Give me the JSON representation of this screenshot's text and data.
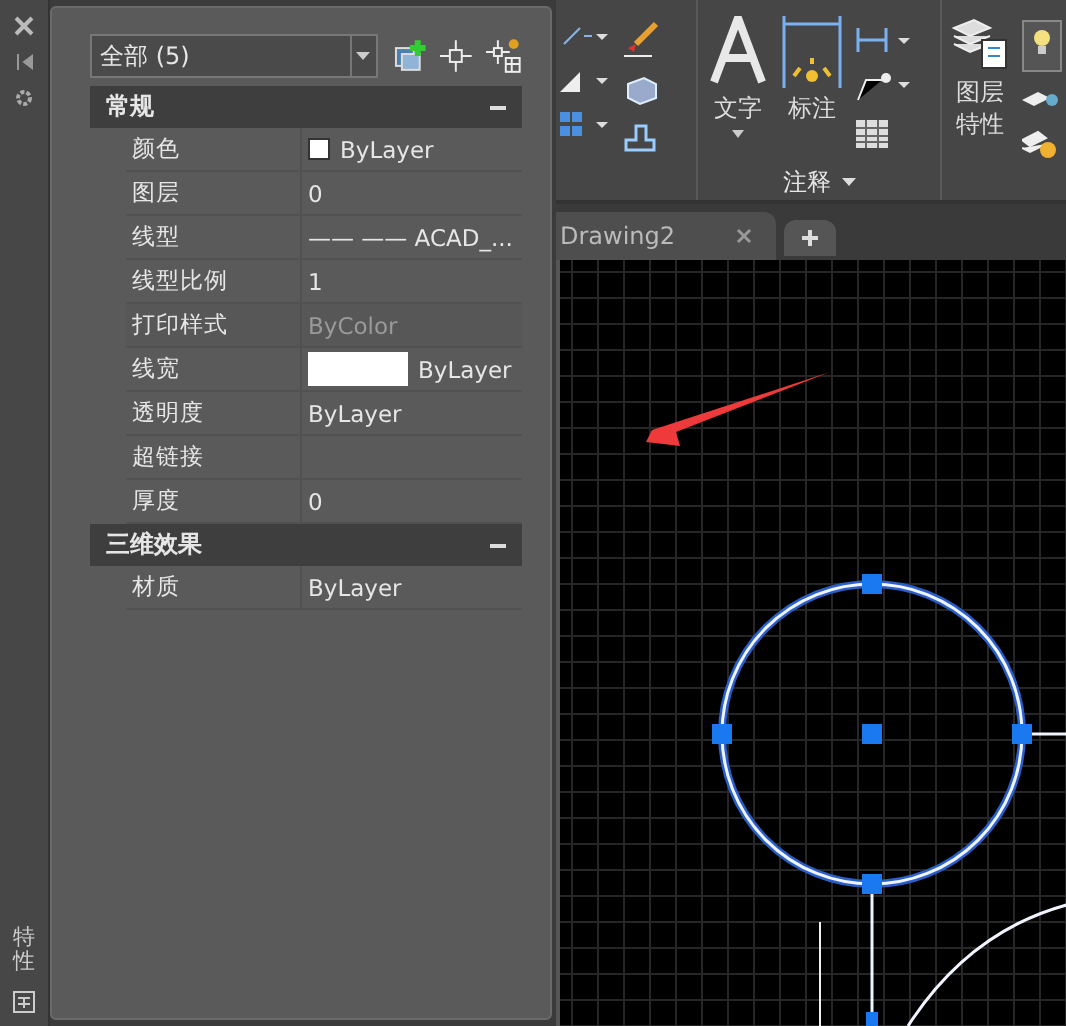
{
  "side_strip": {
    "title": "特性"
  },
  "selector": {
    "value": "全部 (5)"
  },
  "sections": [
    {
      "title": "常规",
      "expanded": true,
      "rows": [
        {
          "label": "颜色",
          "value": "ByLayer",
          "kind": "color",
          "disabled": false
        },
        {
          "label": "图层",
          "value": "0",
          "kind": "text",
          "disabled": false
        },
        {
          "label": "线型",
          "value": "—— —— ACAD_...",
          "kind": "text",
          "disabled": false
        },
        {
          "label": "线型比例",
          "value": "1",
          "kind": "text",
          "disabled": false
        },
        {
          "label": "打印样式",
          "value": "ByColor",
          "kind": "text",
          "disabled": true
        },
        {
          "label": "线宽",
          "value": "ByLayer",
          "kind": "lineweight",
          "disabled": false
        },
        {
          "label": "透明度",
          "value": "ByLayer",
          "kind": "text",
          "disabled": false
        },
        {
          "label": "超链接",
          "value": "",
          "kind": "text",
          "disabled": false
        },
        {
          "label": "厚度",
          "value": "0",
          "kind": "text",
          "disabled": false
        }
      ]
    },
    {
      "title": "三维效果",
      "expanded": true,
      "rows": [
        {
          "label": "材质",
          "value": "ByLayer",
          "kind": "text",
          "disabled": false
        }
      ]
    }
  ],
  "ribbon": {
    "buttons": [
      {
        "label": "文字",
        "kind": "text"
      },
      {
        "label": "标注",
        "kind": "dimension"
      },
      {
        "label": "图层特性",
        "kind": "layers"
      }
    ],
    "panel_title": "注释"
  },
  "tabs": [
    {
      "label": "Drawing2"
    }
  ]
}
